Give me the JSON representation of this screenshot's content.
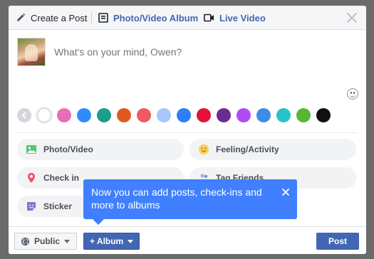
{
  "header": {
    "create_post_label": "Create a Post",
    "photo_album_label": "Photo/Video Album",
    "live_video_label": "Live Video"
  },
  "composer": {
    "placeholder": "What's on your mind, Owen?"
  },
  "background_colors": [
    "#ffffff",
    "#e76fb5",
    "#2f8bff",
    "#1b9e8a",
    "#e05a1f",
    "#f05a63",
    "#a7c6fa",
    "#2d7ff9",
    "#e4113b",
    "#6b2d8f",
    "#b04cf5",
    "#3f8be8",
    "#28c3c8",
    "#56b833",
    "#111111"
  ],
  "actions": {
    "photo_video": "Photo/Video",
    "feeling_activity": "Feeling/Activity",
    "check_in": "Check in",
    "tag_friends": "Tag Friends",
    "sticker": "Sticker"
  },
  "tooltip": {
    "text": "Now you can add posts, check-ins and more to albums"
  },
  "footer": {
    "privacy_label": "Public",
    "album_label": "+ Album",
    "post_label": "Post"
  },
  "colors": {
    "brand": "#4267b2",
    "tooltip": "#4080ff"
  }
}
